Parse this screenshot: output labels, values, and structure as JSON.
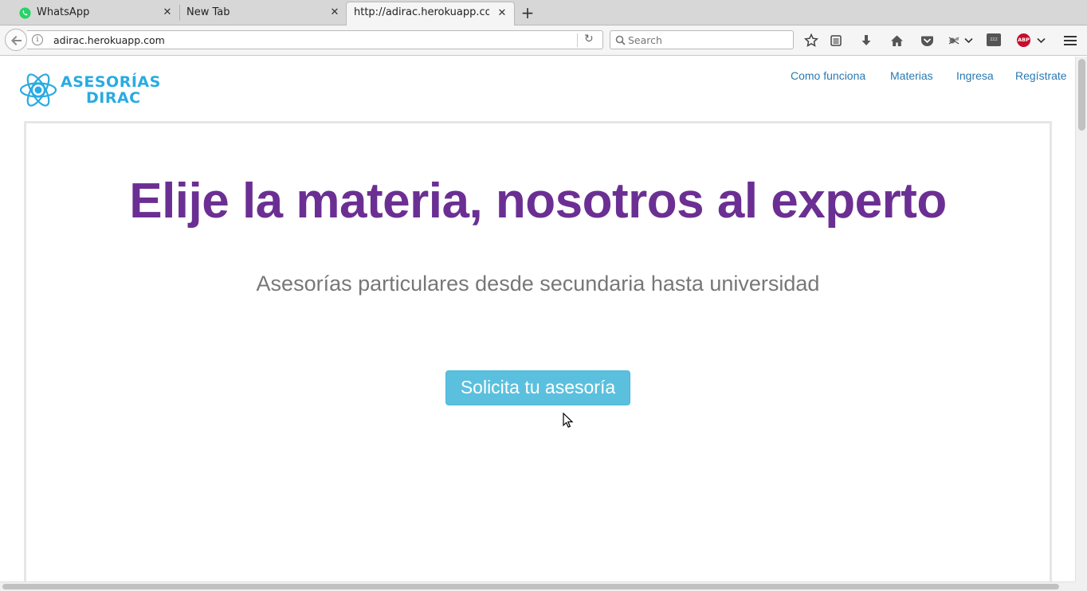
{
  "browser": {
    "tabs": [
      {
        "title": "WhatsApp",
        "icon": "whatsapp-icon",
        "active": false
      },
      {
        "title": "New Tab",
        "icon": "",
        "active": false
      },
      {
        "title": "http://adirac.herokuapp.com/",
        "icon": "",
        "active": true
      }
    ],
    "url": "adirac.herokuapp.com",
    "search_placeholder": "Search",
    "toolbar_icons": [
      "bookmark-star-icon",
      "reading-list-icon",
      "downloads-icon",
      "home-icon",
      "pocket-icon",
      "extension-icon",
      "zzz-icon",
      "adblock-plus-icon",
      "menu-icon"
    ],
    "abp_label": "ABP",
    "zzz_label": "zzz"
  },
  "site": {
    "logo_line1": "ASESORÍAS",
    "logo_line2": "DIRAC",
    "nav": [
      "Como funciona",
      "Materias",
      "Ingresa",
      "Regístrate"
    ]
  },
  "hero": {
    "title": "Elije la materia, nosotros al experto",
    "subtitle": "Asesorías particulares desde secundaria hasta universidad",
    "cta": "Solicita tu asesoría"
  },
  "colors": {
    "brand_blue": "#29abe2",
    "title_purple": "#6b2f93",
    "cta_blue": "#5bc0de",
    "nav_link": "#2a7ab0"
  }
}
